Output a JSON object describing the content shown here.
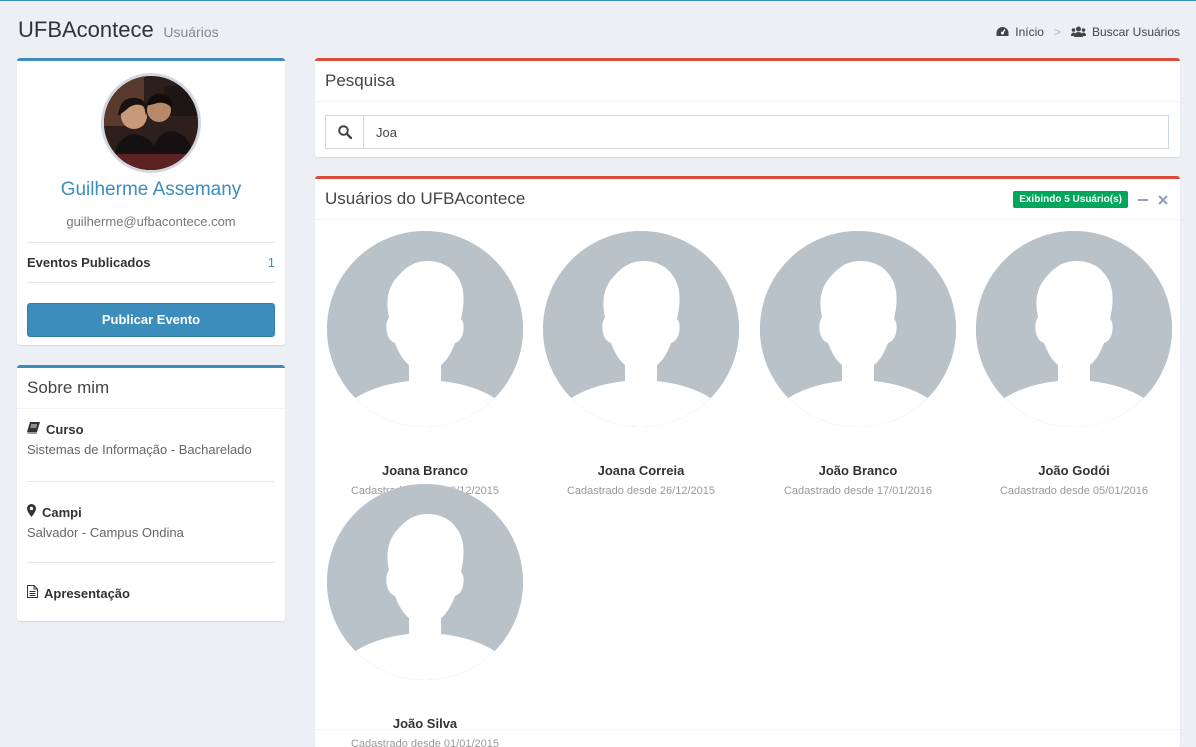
{
  "header": {
    "title": "UFBAcontece",
    "subtitle": "Usuários",
    "breadcrumb": [
      {
        "label": "Início",
        "icon": "dashboard-icon"
      },
      {
        "label": "Buscar Usuários",
        "icon": "users-icon"
      }
    ],
    "separator": ">"
  },
  "profile": {
    "name": "Guilherme Assemany",
    "email": "guilherme@ufbacontece.com",
    "stat_label": "Eventos Publicados",
    "stat_value": "1",
    "publish_button": "Publicar Evento"
  },
  "about": {
    "title": "Sobre mim",
    "items": [
      {
        "label": "Curso",
        "icon": "book-icon",
        "value": "Sistemas de Informação - Bacharelado"
      },
      {
        "label": "Campi",
        "icon": "map-marker-icon",
        "value": "Salvador - Campus Ondina"
      },
      {
        "label": "Apresentação",
        "icon": "file-text-icon",
        "value": ""
      }
    ]
  },
  "search": {
    "title": "Pesquisa",
    "value": "Joa",
    "icon": "search-icon"
  },
  "users": {
    "title": "Usuários do UFBAcontece",
    "badge": "Exibindo 5 Usuário(s)",
    "list": [
      {
        "name": "Joana Branco",
        "date": "Cadastrado desde 30/12/2015"
      },
      {
        "name": "Joana Correia",
        "date": "Cadastrado desde 26/12/2015"
      },
      {
        "name": "João Branco",
        "date": "Cadastrado desde 17/01/2016"
      },
      {
        "name": "João Godói",
        "date": "Cadastrado desde 05/01/2016"
      },
      {
        "name": "João Silva",
        "date": "Cadastrado desde 01/01/2015"
      }
    ]
  },
  "colors": {
    "primary": "#3c8dbc",
    "danger": "#dd4b39",
    "success": "#00a65a",
    "background": "#ecf0f5"
  }
}
